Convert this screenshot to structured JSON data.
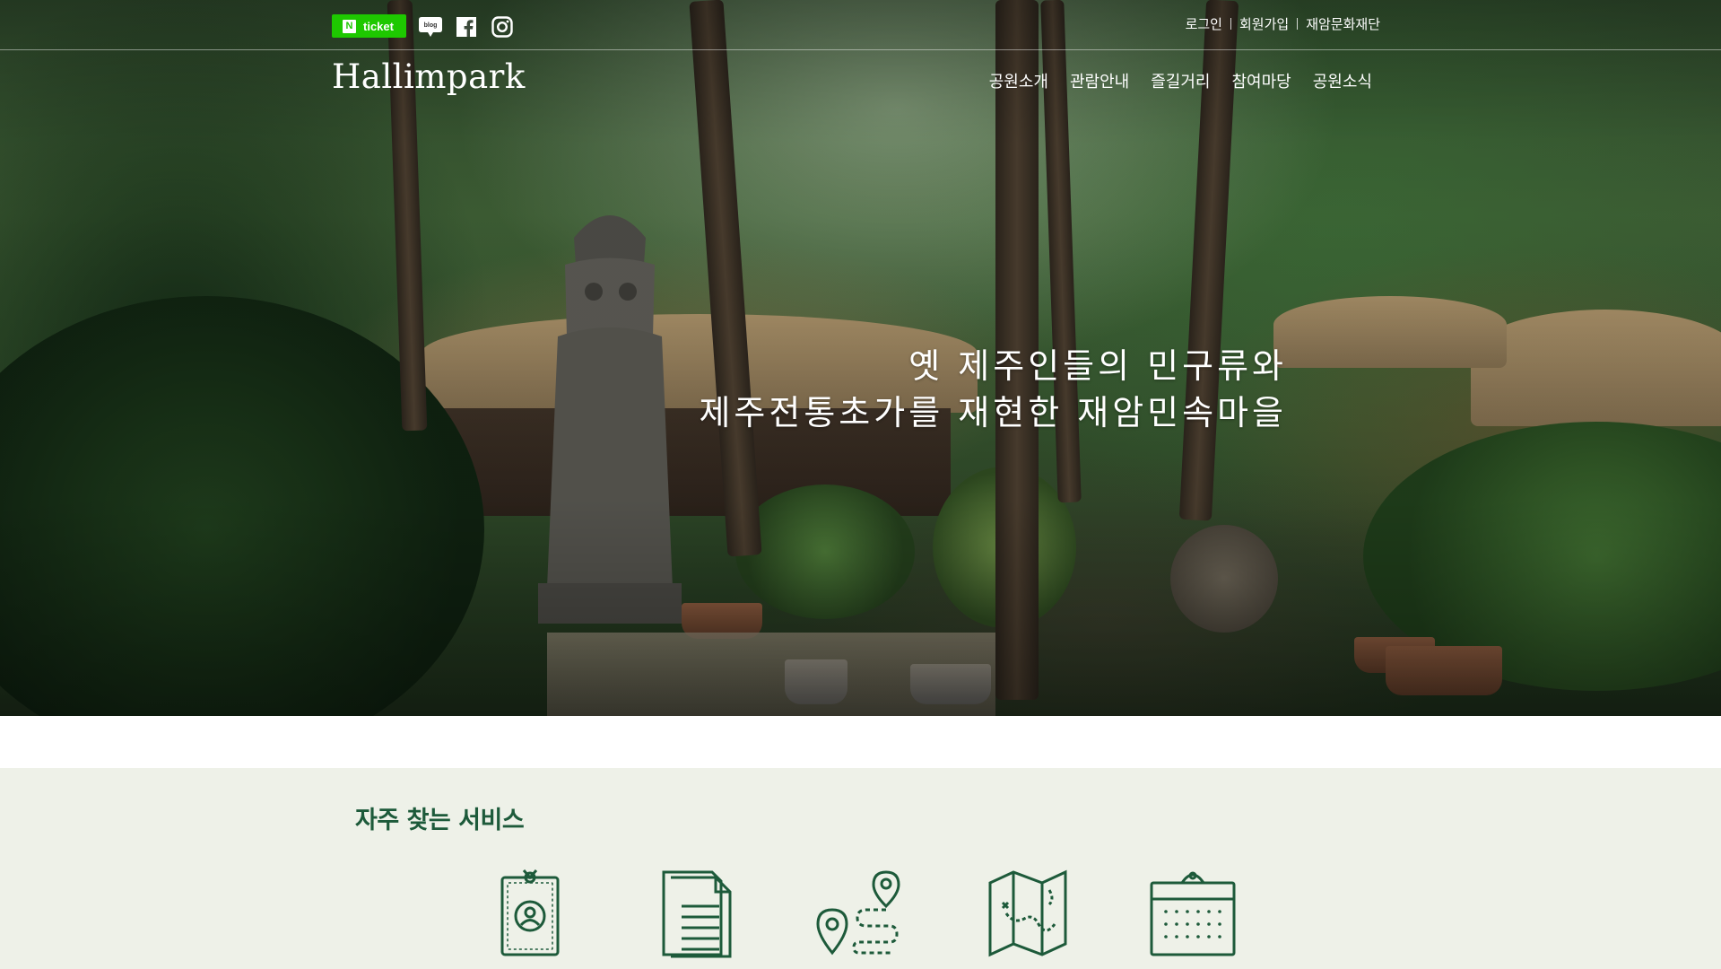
{
  "header": {
    "ticket_label": "ticket",
    "naver_mark": "N",
    "blog_label": "blog",
    "util_links": [
      "로그인",
      "회원가입",
      "재암문화재단"
    ],
    "logo_text": "Hallimpark",
    "nav": [
      "공원소개",
      "관람안내",
      "즐길거리",
      "참여마당",
      "공원소식"
    ]
  },
  "hero": {
    "headline_line1": "옛 제주인들의 민구류와",
    "headline_line2": "제주전통초가를 재현한 재암민속마을"
  },
  "services": {
    "title": "자주 찾는 서비스",
    "items": [
      {
        "icon": "membership-card-icon"
      },
      {
        "icon": "document-icon"
      },
      {
        "icon": "route-map-icon"
      },
      {
        "icon": "folded-map-icon"
      },
      {
        "icon": "calendar-icon"
      }
    ]
  },
  "colors": {
    "ticket_green": "#1ec800",
    "brand_dark_green": "#1d5a3a",
    "services_bg": "#eef1e8"
  }
}
